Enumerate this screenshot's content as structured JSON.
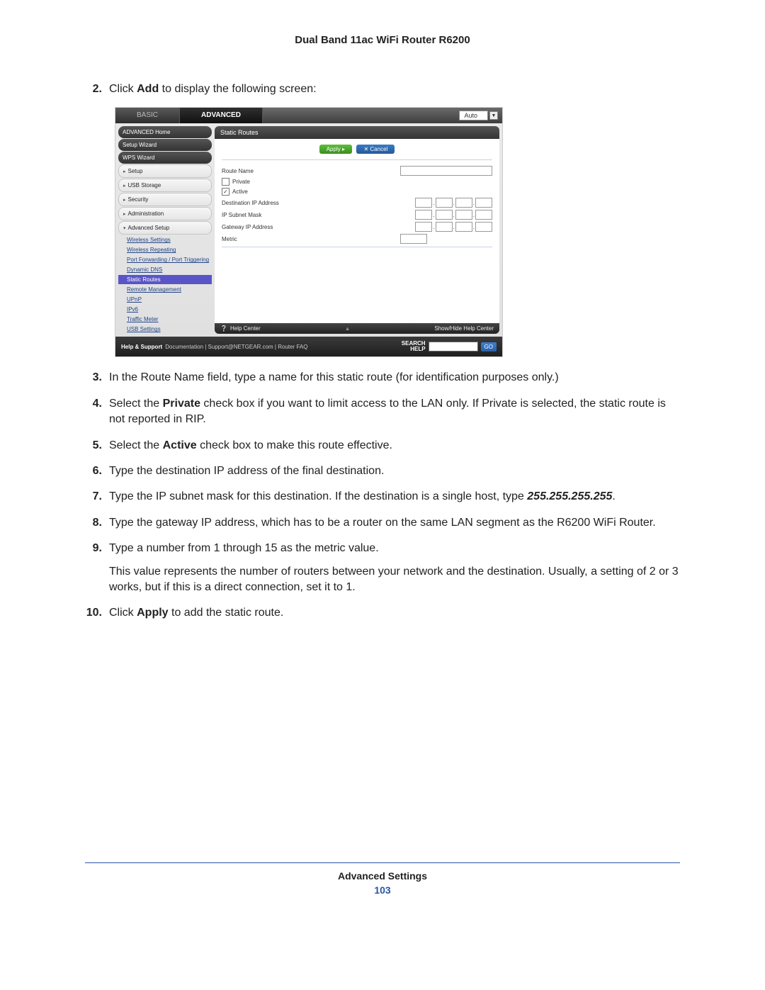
{
  "header": {
    "title": "Dual Band 11ac WiFi Router R6200"
  },
  "footer": {
    "section": "Advanced Settings",
    "page": "103"
  },
  "steps": [
    {
      "n": "2.",
      "html": "Click <b>Add</b> to display the following screen:"
    },
    {
      "n": "3.",
      "html": "In the Route Name field, type a name for this static route (for identification purposes only.)"
    },
    {
      "n": "4.",
      "html": "Select the <b>Private</b> check box if you want to limit access to the LAN only. If Private is selected, the static route is not reported in RIP."
    },
    {
      "n": "5.",
      "html": "Select the <b>Active</b> check box to make this route effective."
    },
    {
      "n": "6.",
      "html": "Type the destination IP address of the final destination."
    },
    {
      "n": "7.",
      "html": "Type the IP subnet mask for this destination. If the destination is a single host, type <i>255.255.255.255</i>."
    },
    {
      "n": "8.",
      "html": "Type the gateway IP address, which has to be a router on the same LAN segment as the R6200 WiFi Router."
    },
    {
      "n": "9.",
      "html": "Type a number from 1 through 15 as the metric value.",
      "extra": "This value represents the number of routers between your network and the destination. Usually, a setting of 2 or 3 works, but if this is a direct connection, set it to 1."
    },
    {
      "n": "10.",
      "html": "Click <b>Apply</b> to add the static route."
    }
  ],
  "router": {
    "tabs": {
      "basic": "BASIC",
      "advanced": "ADVANCED",
      "auto": "Auto"
    },
    "sidebar": {
      "top": [
        "ADVANCED Home",
        "Setup Wizard",
        "WPS Wizard"
      ],
      "groups": [
        "Setup",
        "USB Storage",
        "Security",
        "Administration"
      ],
      "expanded_group": "Advanced Setup",
      "subitems": [
        "Wireless Settings",
        "Wireless Repeating",
        "Port Forwarding / Port Triggering",
        "Dynamic DNS",
        "Static Routes",
        "Remote Management",
        "UPnP",
        "IPv6",
        "Traffic Meter",
        "USB Settings"
      ],
      "selected": "Static Routes"
    },
    "panel": {
      "title": "Static Routes",
      "apply": "Apply ▸",
      "cancel": "✕ Cancel",
      "rows": {
        "route_name": "Route Name",
        "private": "Private",
        "active": "Active",
        "dest": "Destination IP Address",
        "mask": "IP Subnet Mask",
        "gw": "Gateway IP Address",
        "metric": "Metric"
      },
      "active_checked": "✓"
    },
    "helpbar": {
      "left": "Help Center",
      "right": "Show/Hide Help Center"
    },
    "footer": {
      "label": "Help & Support",
      "links": "Documentation  |  Support@NETGEAR.com  |  Router FAQ",
      "search_label_a": "SEARCH",
      "search_label_b": "HELP",
      "go": "GO"
    }
  }
}
